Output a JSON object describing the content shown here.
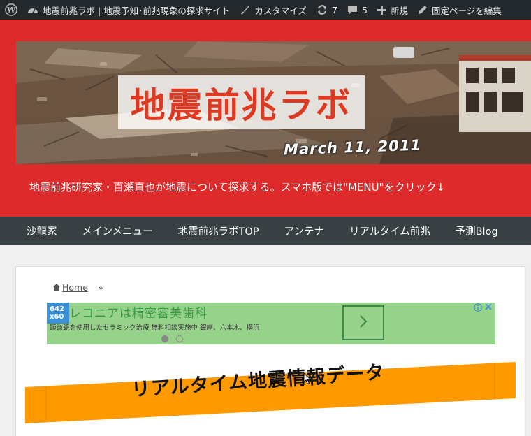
{
  "admin_bar": {
    "site_title": "地震前兆ラボ | 地震予知･前兆現象の探求サイト",
    "customize": "カスタマイズ",
    "updates_count": "7",
    "comments_count": "5",
    "new": "新規",
    "edit_page": "固定ページを編集"
  },
  "header": {
    "banner_title": "地震前兆ラボ",
    "banner_date": "March 11, 2011",
    "tagline": "地震前兆研究家・百瀬直也が地震について探求する。スマホ版では\"MENU\"をクリック↓"
  },
  "nav": {
    "items": [
      "沙龍家",
      "メインメニュー",
      "地震前兆ラボTOP",
      "アンテナ",
      "リアルタイム前兆",
      "予測Blog"
    ]
  },
  "breadcrumb": {
    "home": "Home",
    "separator": "»"
  },
  "ad": {
    "badge_top": "642",
    "badge_bottom": "x60",
    "title": "レコニアは精密審美歯科",
    "description": "顕微鏡を使用したセラミック治療 無料相談実施中 銀座、六本木、横浜",
    "info_icon": "info-icon",
    "close_icon": "close-icon"
  },
  "page_heading": "リアルタイム地震情報データ",
  "colors": {
    "admin_bar": "#23282d",
    "header_red": "#dd2a2a",
    "nav_bg": "#394043",
    "ad_green": "#97d28b",
    "heading_orange": "#ff9900"
  }
}
